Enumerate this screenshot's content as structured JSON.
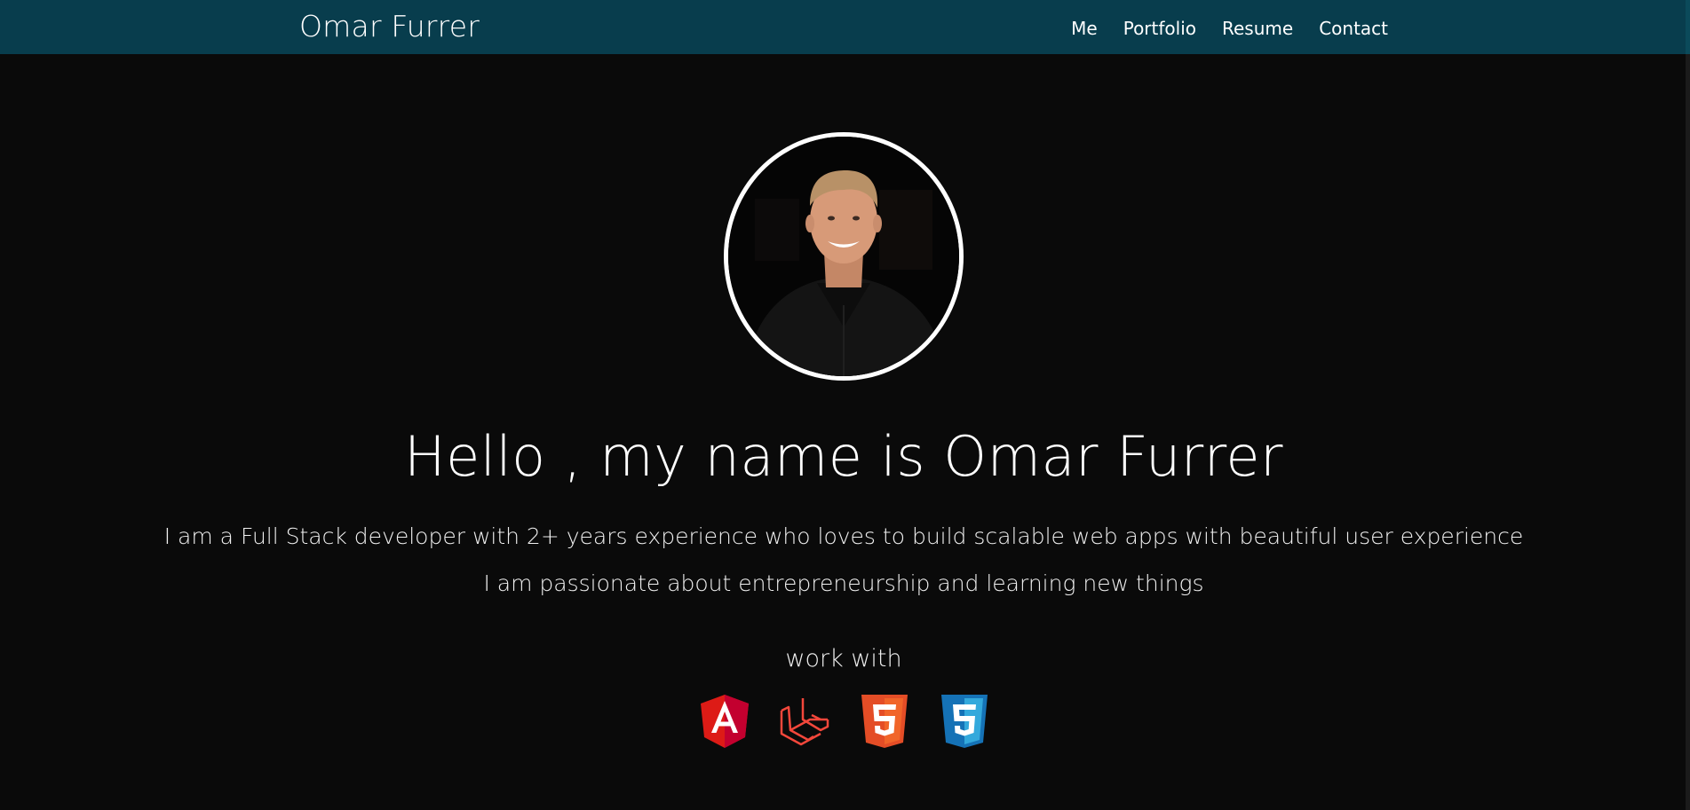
{
  "navbar": {
    "brand": "Omar Furrer",
    "links": [
      "Me",
      "Portfolio",
      "Resume",
      "Contact"
    ]
  },
  "hero": {
    "avatar_alt": "Profile photo of Omar Furrer",
    "headline": "Hello , my name is Omar Furrer",
    "intro_lines": [
      "I am a Full Stack developer with 2+ years experience who loves to build scalable web apps with beautiful user experience",
      "I am passionate about entrepreneurship and learning new things"
    ],
    "work_with_label": "work with",
    "technologies": [
      {
        "name": "Angular",
        "icon": "angular-icon",
        "color": "#dd1b16"
      },
      {
        "name": "Laravel",
        "icon": "laravel-icon",
        "color": "#f4473b"
      },
      {
        "name": "HTML5",
        "icon": "html5-icon",
        "color": "#e44d26"
      },
      {
        "name": "CSS3",
        "icon": "css3-icon",
        "color": "#1572b6"
      }
    ]
  },
  "colors": {
    "navbar_background": "#083d4d",
    "page_background": "#0a0a0a",
    "text": "#ffffff"
  }
}
